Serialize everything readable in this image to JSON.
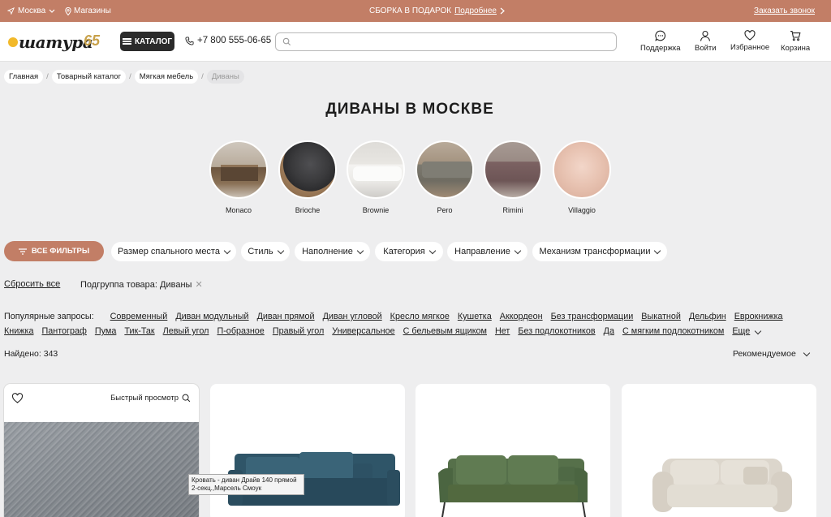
{
  "topbar": {
    "city": "Москва",
    "shops": "Магазины",
    "promo_text": "СБОРКА В ПОДАРОК",
    "promo_link": "Подробнее",
    "callback": "Заказать звонок"
  },
  "header": {
    "logo": "шатура",
    "anniversary": "65",
    "catalog": "КАТАЛОГ",
    "phone": "+7 800 555-06-65",
    "search_value": "",
    "nav": [
      {
        "label": "Поддержка",
        "icon": "chat-icon"
      },
      {
        "label": "Войти",
        "icon": "user-icon"
      },
      {
        "label": "Избранное",
        "icon": "heart-icon"
      },
      {
        "label": "Корзина",
        "icon": "cart-icon"
      }
    ]
  },
  "breadcrumbs": [
    "Главная",
    "Товарный каталог",
    "Мягкая мебель",
    "Диваны"
  ],
  "page_title": "ДИВАНЫ В МОСКВЕ",
  "collections": [
    "Monaco",
    "Brioche",
    "Brownie",
    "Pero",
    "Rimini",
    "Villaggio"
  ],
  "filters": {
    "all": "ВСЕ ФИЛЬТРЫ",
    "items": [
      "Размер спального места",
      "Стиль",
      "Наполнение",
      "Категория",
      "Направление",
      "Механизм трансформации"
    ],
    "reset": "Сбросить все",
    "active": "Подгруппа товара: Диваны"
  },
  "popular": {
    "label": "Популярные запросы:",
    "queries": [
      "Современный",
      "Диван модульный",
      "Диван прямой",
      "Диван угловой",
      "Кресло мягкое",
      "Кушетка",
      "Аккордеон",
      "Без трансформации",
      "Выкатной",
      "Дельфин",
      "Еврокнижка",
      "Книжка",
      "Пантограф",
      "Пума",
      "Тик-Так",
      "Левый угол",
      "П-образное",
      "Правый угол",
      "Универсальное",
      "С бельевым ящиком",
      "Нет",
      "Без подлокотников",
      "Да",
      "С мягким подлокотником"
    ],
    "more": "Еще"
  },
  "results": {
    "found": "Найдено: 343",
    "sort": "Рекомендуемое"
  },
  "card": {
    "quick_view": "Быстрый просмотр",
    "tooltip": "Кровать - диван Драйв 140 прямой 2-секц.,Марсель Смоук"
  },
  "colors": {
    "accent": "#c27e66",
    "dark": "#2b2b2b",
    "background": "#eeeeef"
  }
}
